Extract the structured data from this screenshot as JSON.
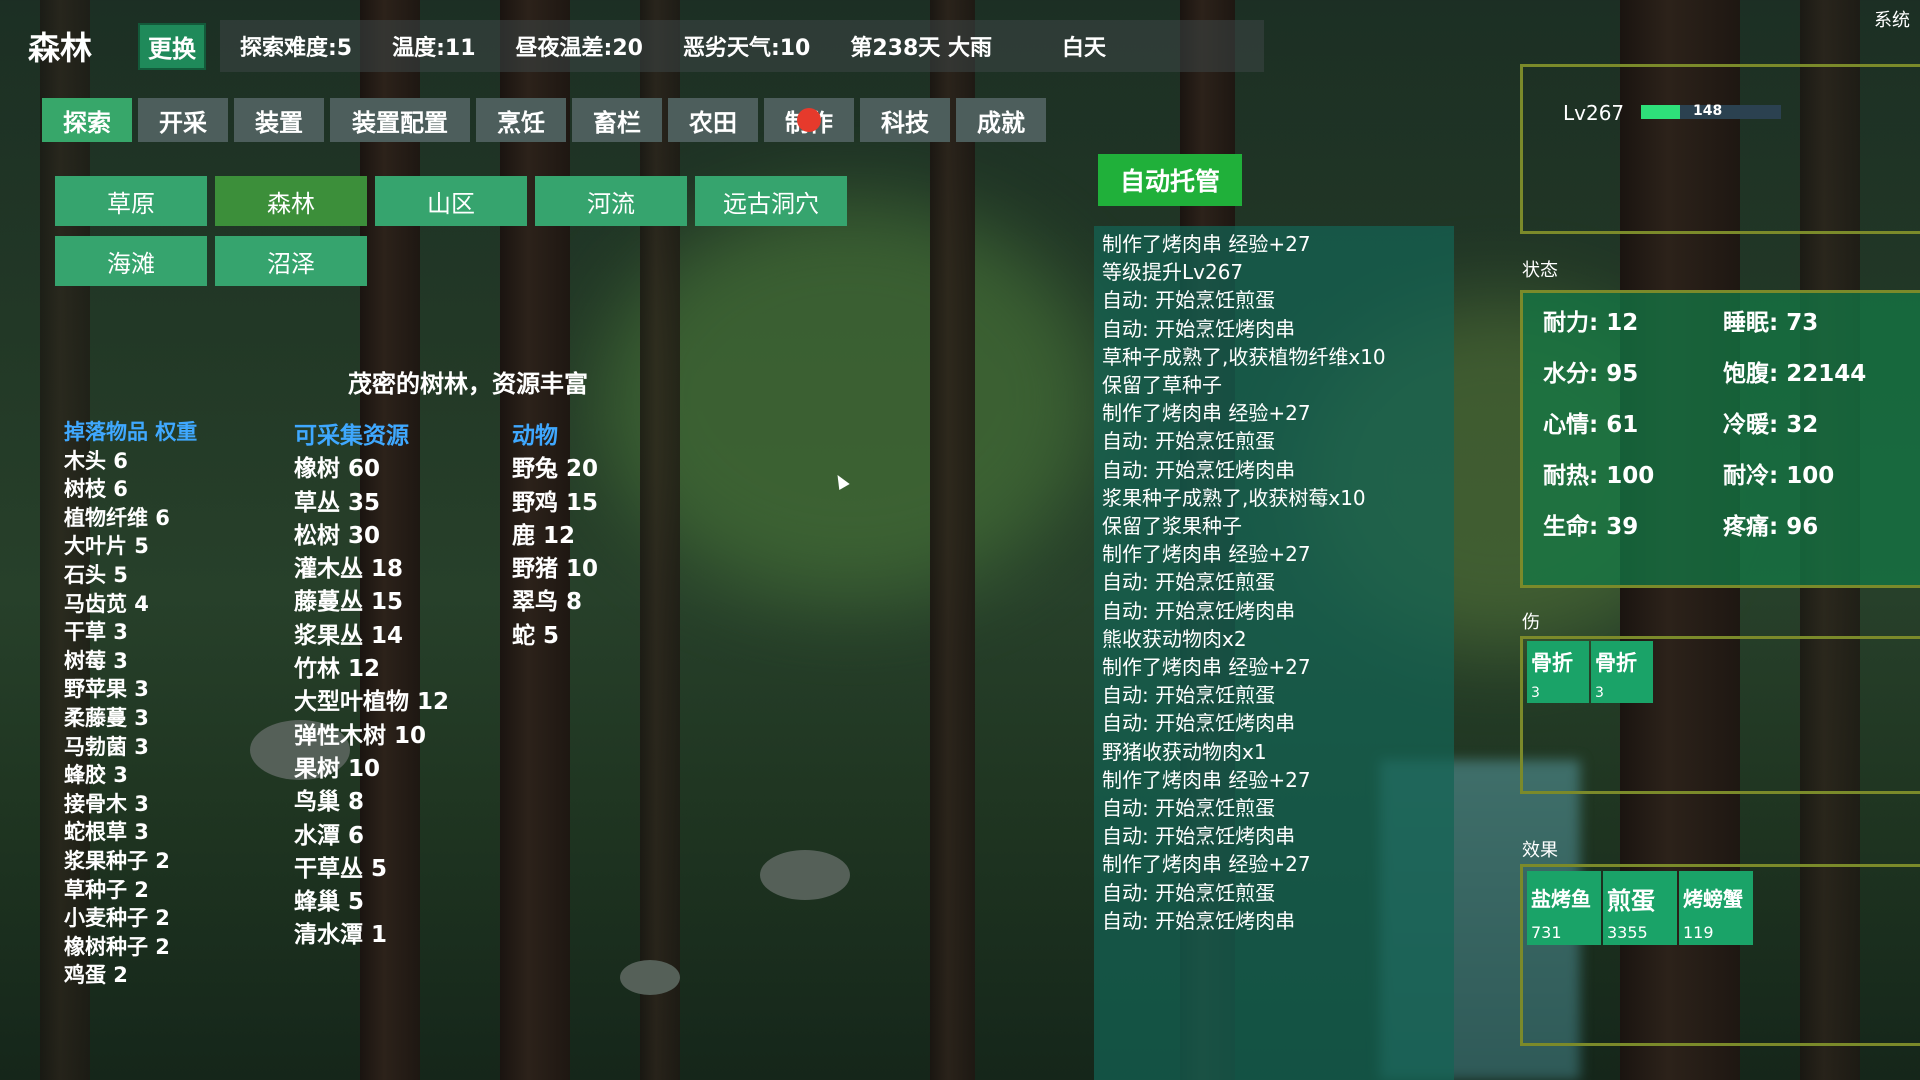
{
  "header": {
    "location": "森林",
    "change_label": "更换",
    "difficulty": "探索难度:5",
    "temperature": "温度:11",
    "temp_diff": "昼夜温差:20",
    "bad_weather": "恶劣天气:10",
    "day_weather": "第238天 大雨",
    "time_of_day": "白天",
    "system": "系统"
  },
  "tabs": [
    "探索",
    "开采",
    "装置",
    "装置配置",
    "烹饪",
    "畜栏",
    "农田",
    "制作",
    "科技",
    "成就"
  ],
  "areas": [
    "草原",
    "森林",
    "山区",
    "河流",
    "远古洞穴",
    "海滩",
    "沼泽"
  ],
  "area_desc": "茂密的树林，资源丰富",
  "drops": {
    "header": "掉落物品 权重",
    "items": [
      "木头 6",
      "树枝 6",
      "植物纤维 6",
      "大叶片 5",
      "石头 5",
      "马齿苋 4",
      "干草 3",
      "树莓 3",
      "野苹果 3",
      "柔藤蔓 3",
      "马勃菌 3",
      "蜂胶 3",
      "接骨木 3",
      "蛇根草 3",
      "浆果种子 2",
      "草种子 2",
      "小麦种子 2",
      "橡树种子 2",
      "鸡蛋 2"
    ]
  },
  "resources": {
    "header": "可采集资源",
    "items": [
      "橡树 60",
      "草丛 35",
      "松树 30",
      "灌木丛 18",
      "藤蔓丛 15",
      "浆果丛 14",
      "竹林 12",
      "大型叶植物 12",
      "弹性木树 10",
      "果树 10",
      "鸟巢 8",
      "水潭 6",
      "干草丛 5",
      "蜂巢 5",
      "清水潭 1"
    ]
  },
  "animals": {
    "header": "动物",
    "items": [
      "野兔 20",
      "野鸡 15",
      "鹿 12",
      "野猪 10",
      "翠鸟 8",
      "蛇 5"
    ]
  },
  "auto_label": "自动托管",
  "log": [
    "制作了烤肉串 经验+27",
    "等级提升Lv267",
    "自动: 开始烹饪煎蛋",
    "自动: 开始烹饪烤肉串",
    "草种子成熟了,收获植物纤维x10",
    "保留了草种子",
    "制作了烤肉串 经验+27",
    "自动: 开始烹饪煎蛋",
    "自动: 开始烹饪烤肉串",
    "浆果种子成熟了,收获树莓x10",
    "保留了浆果种子",
    "制作了烤肉串 经验+27",
    "自动: 开始烹饪煎蛋",
    "自动: 开始烹饪烤肉串",
    "熊收获动物肉x2",
    "制作了烤肉串 经验+27",
    "自动: 开始烹饪煎蛋",
    "自动: 开始烹饪烤肉串",
    "野猪收获动物肉x1",
    "制作了烤肉串 经验+27",
    "自动: 开始烹饪煎蛋",
    "自动: 开始烹饪烤肉串",
    "制作了烤肉串 经验+27",
    "自动: 开始烹饪煎蛋",
    "自动: 开始烹饪烤肉串"
  ],
  "level": {
    "label": "Lv267",
    "xp": "148",
    "xp_fraction": 0.28
  },
  "status": {
    "label": "状态",
    "stamina": "耐力: 12",
    "sleep": "睡眠: 73",
    "water": "水分: 95",
    "satiety": "饱腹: 22144",
    "mood": "心情: 61",
    "warmth": "冷暖: 32",
    "heat_res": "耐热: 100",
    "cold_res": "耐冷: 100",
    "health": "生命: 39",
    "pain": "疼痛: 96"
  },
  "injury": {
    "label": "伤",
    "items": [
      {
        "name": "骨折",
        "count": "3"
      },
      {
        "name": "骨折",
        "count": "3"
      }
    ]
  },
  "effects": {
    "label": "效果",
    "items": [
      {
        "name": "盐烤鱼",
        "count": "731"
      },
      {
        "name": "煎蛋",
        "count": "3355"
      },
      {
        "name": "烤螃蟹",
        "count": "119"
      }
    ]
  },
  "colors": {
    "accent_green": "#37a76a",
    "tab_grey": "#4d5e5c",
    "header_blue": "#3fa8ff",
    "panel_border": "#7b8a2a"
  }
}
